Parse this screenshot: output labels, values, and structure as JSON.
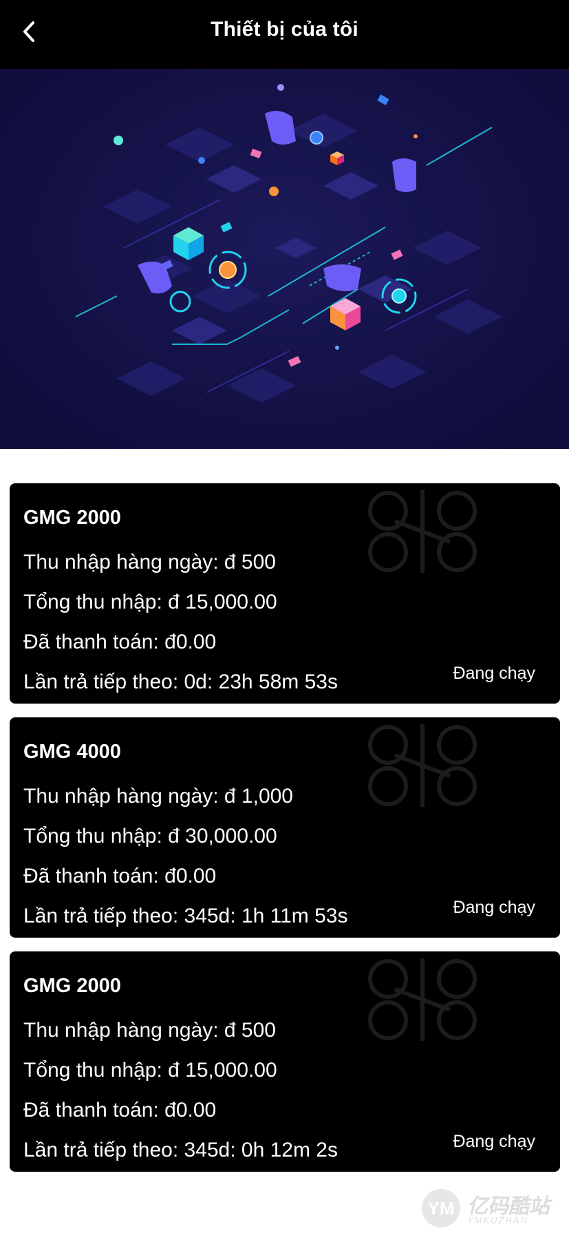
{
  "header": {
    "title": "Thiết bị của tôi"
  },
  "devices": [
    {
      "name": "GMG 2000",
      "daily_income": "Thu nhập hàng ngày: đ 500",
      "total_income": "Tổng thu nhập: đ 15,000.00",
      "paid": "Đã thanh toán: đ0.00",
      "next_payment": "Lần trả tiếp theo: 0d: 23h 58m 53s",
      "status": "Đang chạy"
    },
    {
      "name": "GMG 4000",
      "daily_income": "Thu nhập hàng ngày: đ 1,000",
      "total_income": "Tổng thu nhập: đ 30,000.00",
      "paid": "Đã thanh toán: đ0.00",
      "next_payment": "Lần trả tiếp theo: 345d: 1h 11m 53s",
      "status": "Đang chạy"
    },
    {
      "name": "GMG 2000",
      "daily_income": "Thu nhập hàng ngày: đ 500",
      "total_income": "Tổng thu nhập: đ 15,000.00",
      "paid": "Đã thanh toán: đ0.00",
      "next_payment": "Lần trả tiếp theo: 345d: 0h 12m 2s",
      "status": "Đang chạy"
    }
  ],
  "watermark": {
    "mark": "YM",
    "text": "亿码酷站",
    "sub": "YMKUZHAN"
  },
  "icons": {
    "back": "chevron-left-icon",
    "drone": "drone-icon"
  },
  "colors": {
    "header_bg": "#000000",
    "card_bg": "#000000",
    "hero_bg": "#15134a",
    "accent_cyan": "#22d3ee",
    "accent_purple": "#6d5cf5"
  }
}
